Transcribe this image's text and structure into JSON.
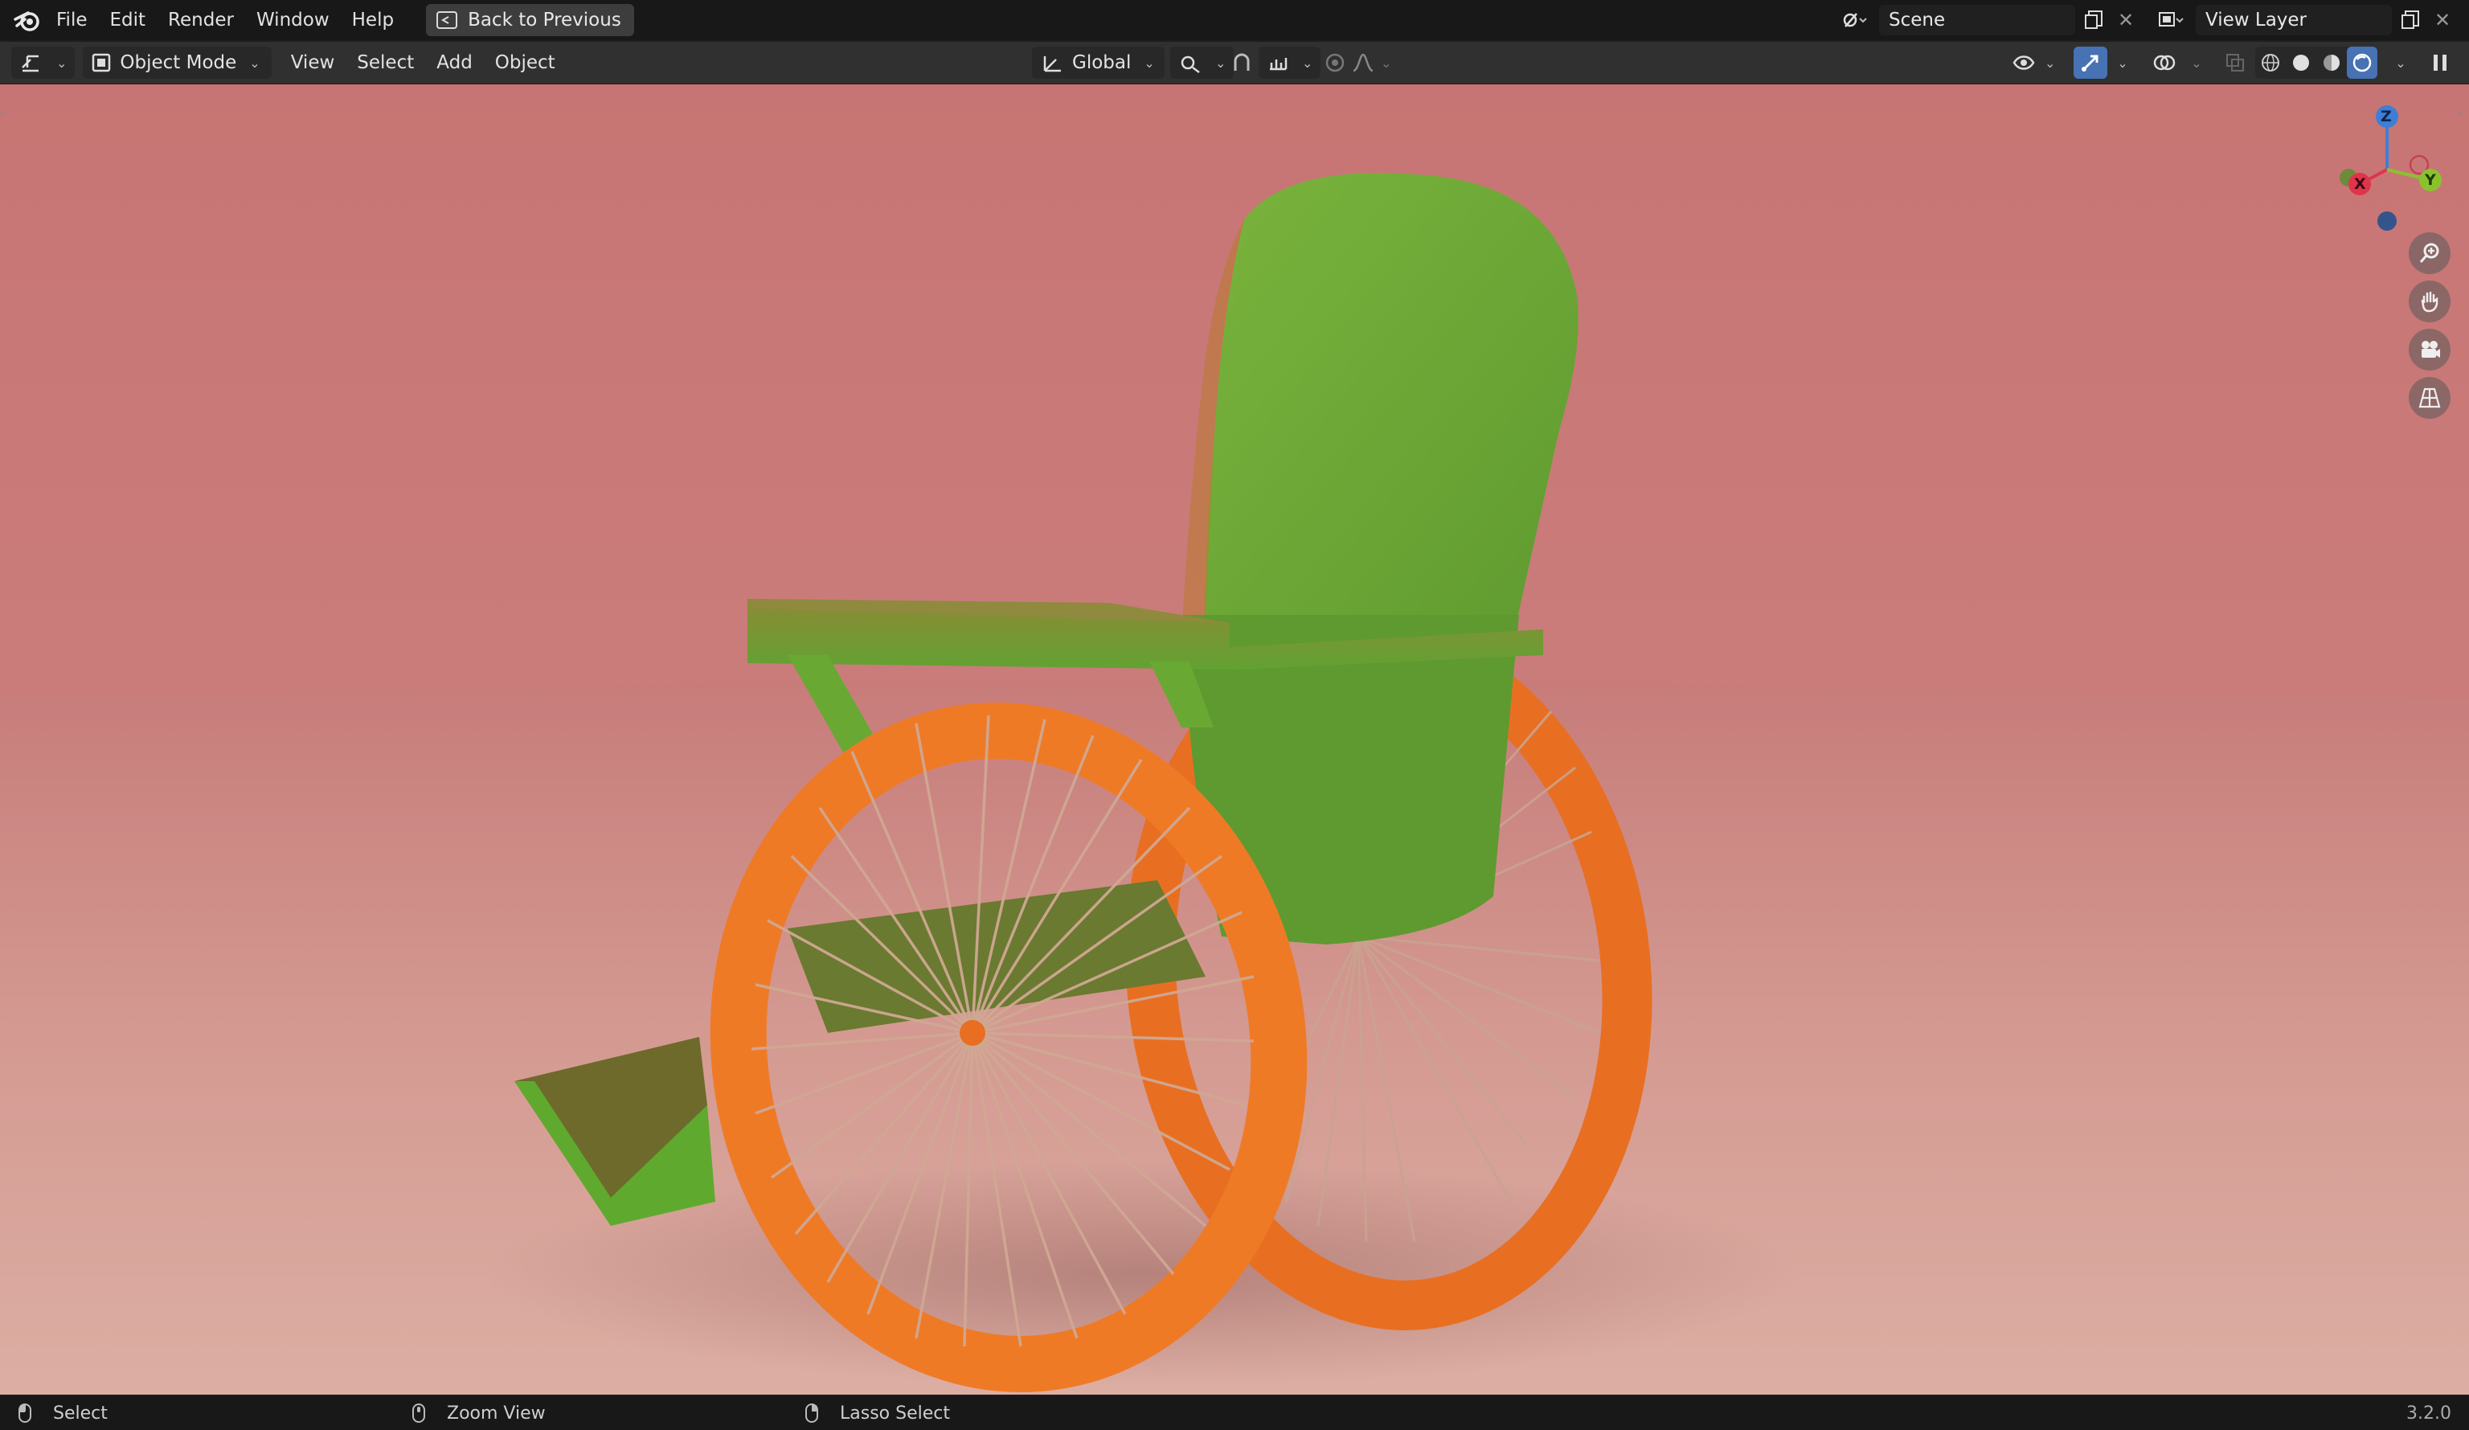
{
  "topbar": {
    "menus": [
      "File",
      "Edit",
      "Render",
      "Window",
      "Help"
    ],
    "back_button": "Back to Previous",
    "scene_label": "Scene",
    "view_layer_label": "View Layer"
  },
  "header": {
    "mode": "Object Mode",
    "menus": [
      "View",
      "Select",
      "Add",
      "Object"
    ],
    "transform_orientation": "Global"
  },
  "gizmo": {
    "z": "Z",
    "x": "X",
    "y": "Y"
  },
  "statusbar": {
    "select": "Select",
    "zoom_view": "Zoom View",
    "lasso_select": "Lasso Select",
    "version": "3.2.0"
  },
  "colors": {
    "wall": "#c97c7b",
    "floor": "#cf8f86",
    "chair_green": "#6fa83a",
    "wheel_orange": "#f07a2a"
  },
  "icons": [
    "blender-logo-icon",
    "back-icon",
    "editor-type-icon",
    "object-mode-icon",
    "orientation-icon",
    "pivot-icon",
    "snap-icon",
    "proportional-icon",
    "visibility-icon",
    "gizmo-icon",
    "overlay-icon",
    "xray-icon",
    "wireframe-shading-icon",
    "solid-shading-icon",
    "material-shading-icon",
    "rendered-shading-icon",
    "zoom-icon",
    "hand-icon",
    "camera-icon",
    "grid-icon",
    "mouse-icon"
  ]
}
